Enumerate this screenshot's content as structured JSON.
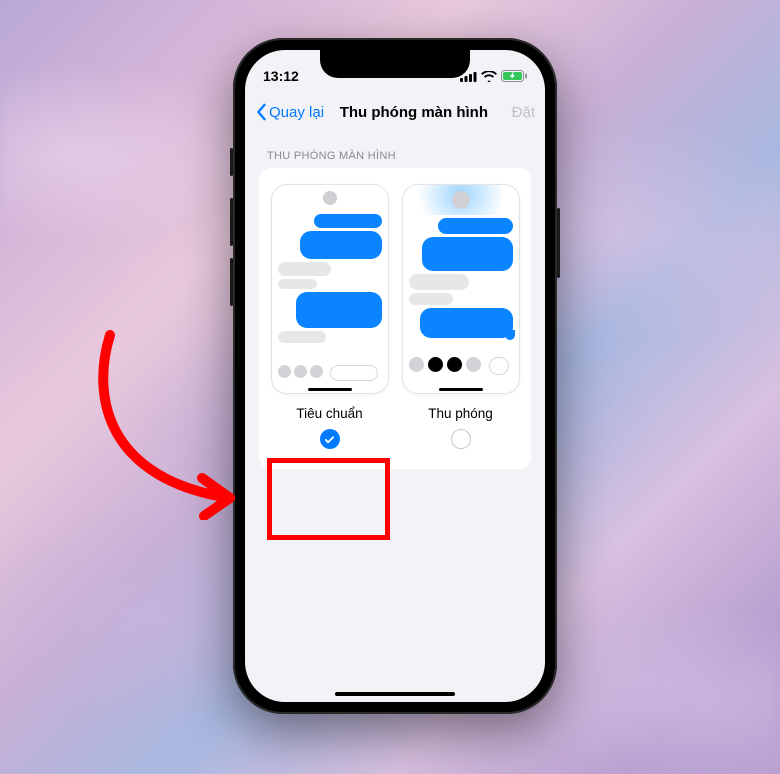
{
  "status": {
    "time": "13:12"
  },
  "nav": {
    "back_label": "Quay lại",
    "title": "Thu phóng màn hình",
    "action_label": "Đặt"
  },
  "section": {
    "header": "THU PHÓNG MÀN HÌNH"
  },
  "options": {
    "standard": {
      "label": "Tiêu chuẩn",
      "selected": true
    },
    "zoomed": {
      "label": "Thu phóng",
      "selected": false
    }
  },
  "colors": {
    "ios_blue": "#007aff",
    "annotation_red": "#ff0000"
  }
}
